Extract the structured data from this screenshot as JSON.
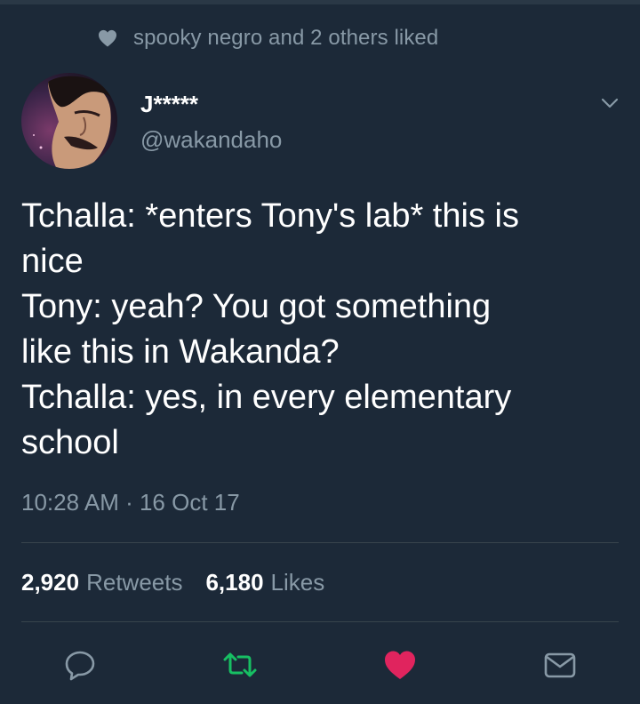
{
  "social_context": {
    "icon": "heart-icon",
    "text": "spooky negro and 2 others liked"
  },
  "author": {
    "display_name": "J*****",
    "handle": "@wakandaho"
  },
  "tweet": {
    "lines": [
      "Tchalla: *enters Tony's lab* this is",
      "nice",
      "Tony: yeah? You got something",
      "like this in Wakanda?",
      "Tchalla: yes, in every elementary",
      "school"
    ],
    "timestamp": "10:28 AM · 16 Oct 17"
  },
  "stats": {
    "retweets_count": "2,920",
    "retweets_label": "Retweets",
    "likes_count": "6,180",
    "likes_label": "Likes"
  },
  "actions": [
    {
      "name": "reply",
      "icon": "reply-icon"
    },
    {
      "name": "retweet",
      "icon": "retweet-icon",
      "color": "#17bf63"
    },
    {
      "name": "like",
      "icon": "heart-icon",
      "color": "#e0245e"
    },
    {
      "name": "share",
      "icon": "envelope-icon"
    }
  ],
  "colors": {
    "background": "#1c2938",
    "secondary_text": "#8899a6",
    "retweet_green": "#17bf63",
    "like_red": "#e0245e",
    "divider": "#38444d"
  }
}
